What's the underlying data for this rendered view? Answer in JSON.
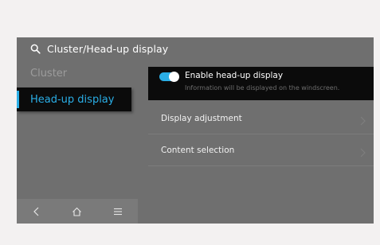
{
  "header": {
    "title": "Cluster/Head-up display",
    "search_icon": "search-icon"
  },
  "sidebar": {
    "items": [
      {
        "label": "Cluster",
        "selected": false
      },
      {
        "label": "Head-up display",
        "selected": true
      }
    ],
    "accent_color": "#2aaee6"
  },
  "settings": {
    "enable_hud": {
      "label": "Enable head-up display",
      "description": "Information will be displayed on the windscreen.",
      "enabled": true
    },
    "rows": [
      {
        "label": "Display adjustment",
        "icon": "chevron-right-icon"
      },
      {
        "label": "Content selection",
        "icon": "chevron-right-icon"
      }
    ]
  },
  "dock": {
    "buttons": [
      "back-icon",
      "home-icon",
      "menu-icon"
    ]
  }
}
